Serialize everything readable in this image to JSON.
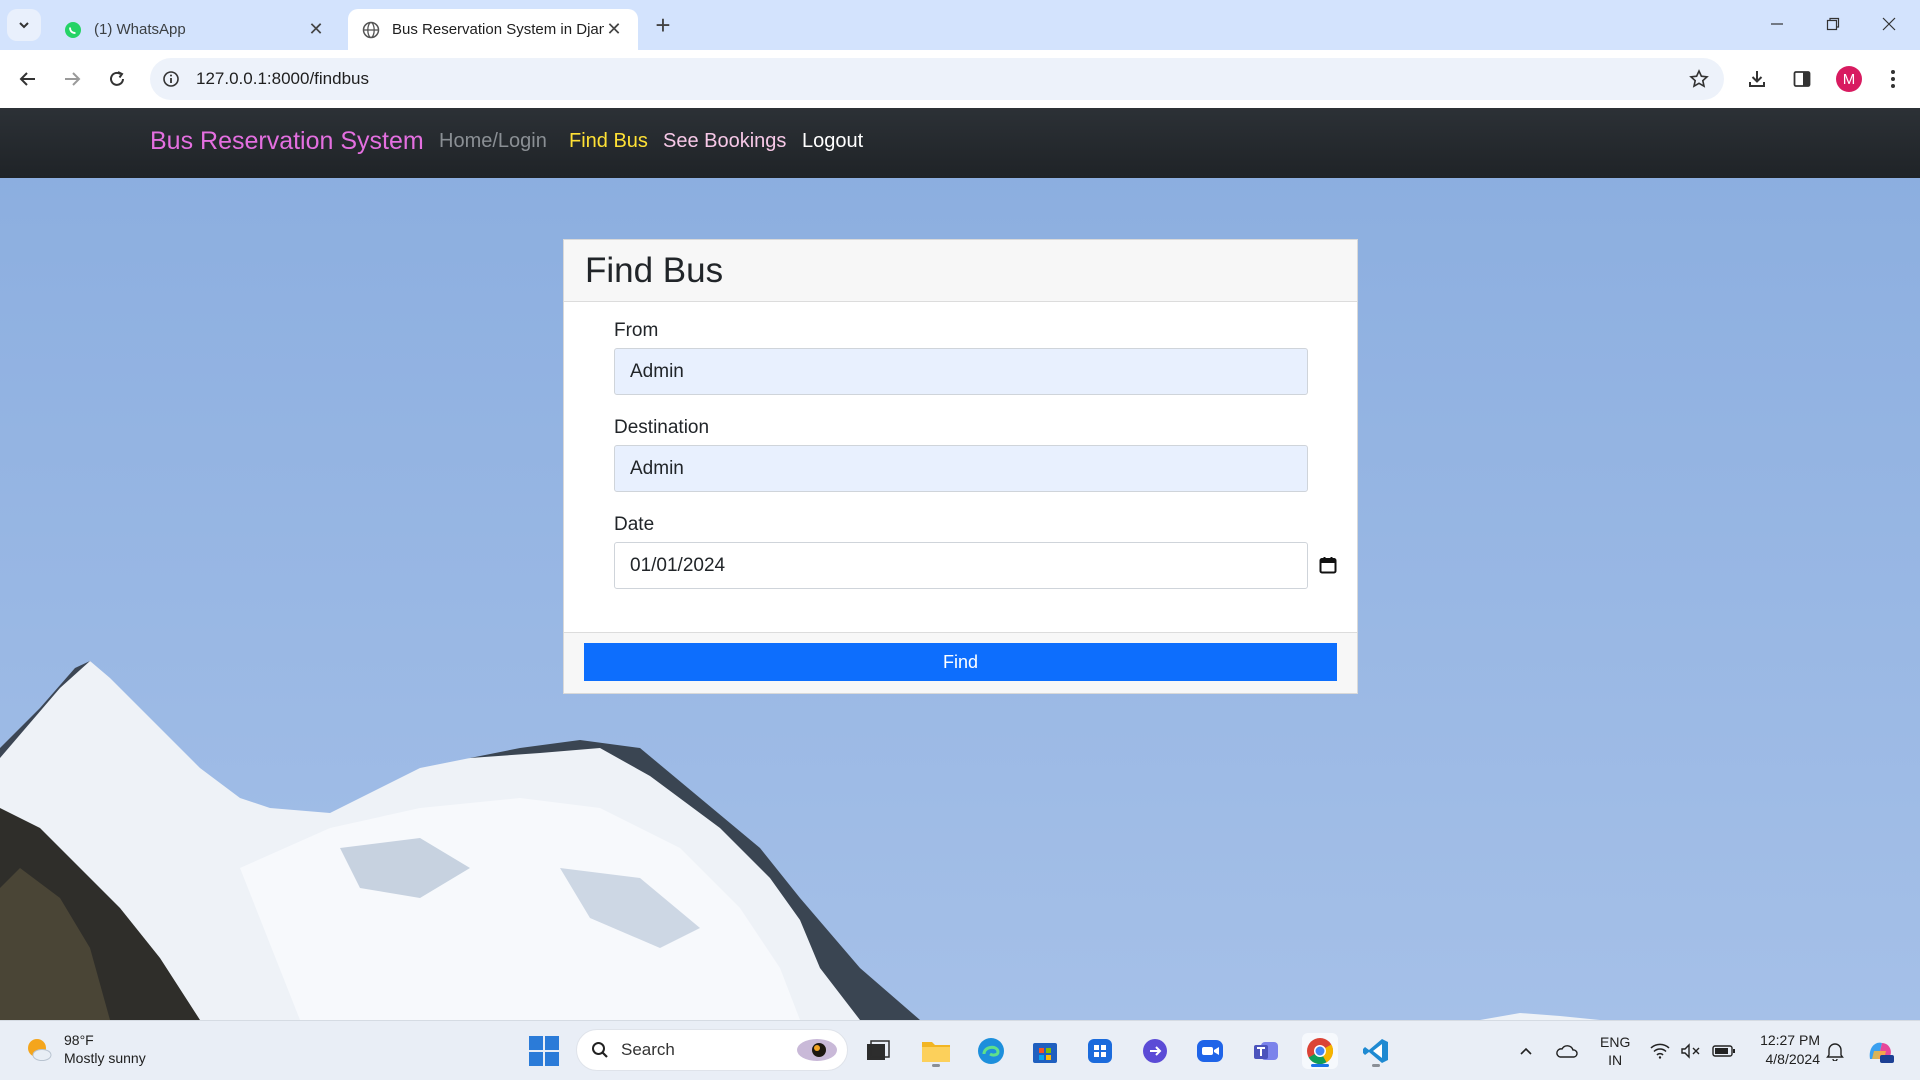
{
  "browser": {
    "tabs": [
      {
        "title": "(1) WhatsApp",
        "icon": "whatsapp-icon",
        "active": false
      },
      {
        "title": "Bus Reservation System in Djan",
        "icon": "globe-icon",
        "active": true
      }
    ],
    "url": "127.0.0.1:8000/findbus",
    "profile_initial": "M"
  },
  "navbar": {
    "brand": "Bus Reservation System",
    "links": [
      {
        "label": "Home/Login",
        "color": "#8a8f94"
      },
      {
        "label": "Find Bus",
        "color": "#ffe135"
      },
      {
        "label": "See Bookings",
        "color": "#f7c8e7"
      },
      {
        "label": "Logout",
        "color": "#ffffff"
      }
    ]
  },
  "form": {
    "title": "Find Bus",
    "fields": [
      {
        "label": "From",
        "value": "Admin"
      },
      {
        "label": "Destination",
        "value": "Admin"
      },
      {
        "label": "Date",
        "value": "01/01/2024"
      }
    ],
    "submit_label": "Find",
    "submit_color": "#0d6efd"
  },
  "taskbar": {
    "weather_temp": "98°F",
    "weather_desc": "Mostly sunny",
    "search_placeholder": "Search",
    "language": "ENG",
    "region": "IN",
    "time": "12:27 PM",
    "date": "4/8/2024"
  }
}
